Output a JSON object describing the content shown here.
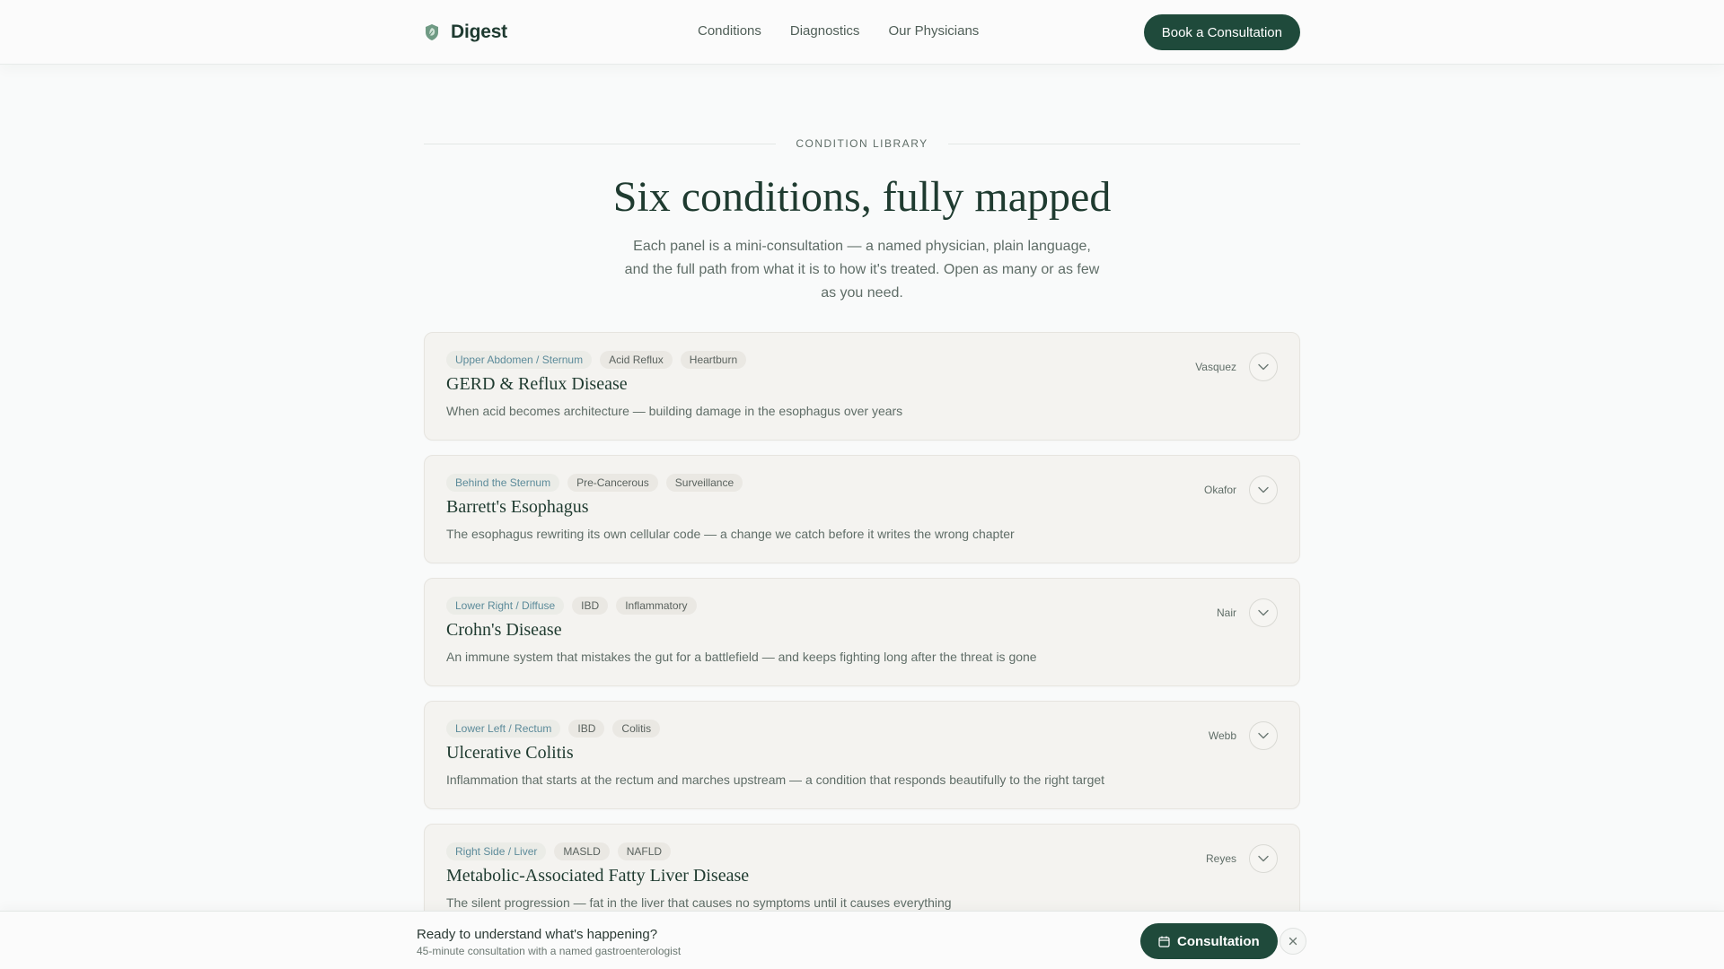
{
  "header": {
    "brand": "Digest",
    "nav": [
      "Conditions",
      "Diagnostics",
      "Our Physicians"
    ],
    "cta": "Book a Consultation"
  },
  "hero": {
    "eyebrow": "CONDITION LIBRARY",
    "title": "Six conditions, fully mapped",
    "subtitle": "Each panel is a mini-consultation — a named physician, plain language, and the full path from what it is to how it's treated. Open as many or as few as you need."
  },
  "conditions": [
    {
      "tags": [
        "Upper Abdomen / Sternum",
        "Acid Reflux",
        "Heartburn"
      ],
      "title": "GERD & Reflux Disease",
      "description": "When acid becomes architecture — building damage in the esophagus over years",
      "physician": "Vasquez"
    },
    {
      "tags": [
        "Behind the Sternum",
        "Pre-Cancerous",
        "Surveillance"
      ],
      "title": "Barrett's Esophagus",
      "description": "The esophagus rewriting its own cellular code — a change we catch before it writes the wrong chapter",
      "physician": "Okafor"
    },
    {
      "tags": [
        "Lower Right / Diffuse",
        "IBD",
        "Inflammatory"
      ],
      "title": "Crohn's Disease",
      "description": "An immune system that mistakes the gut for a battlefield — and keeps fighting long after the threat is gone",
      "physician": "Nair"
    },
    {
      "tags": [
        "Lower Left / Rectum",
        "IBD",
        "Colitis"
      ],
      "title": "Ulcerative Colitis",
      "description": "Inflammation that starts at the rectum and marches upstream — a condition that responds beautifully to the right target",
      "physician": "Webb"
    },
    {
      "tags": [
        "Right Side / Liver",
        "MASLD",
        "NAFLD"
      ],
      "title": "Metabolic-Associated Fatty Liver Disease",
      "description": "The silent progression — fat in the liver that causes no symptoms until it causes everything",
      "physician": "Reyes"
    }
  ],
  "sticky": {
    "title": "Ready to understand what's happening?",
    "subtitle": "45-minute consultation with a named gastroenterologist",
    "button": "Consultation"
  },
  "colors": {
    "brand": "#1f4a3b",
    "card_bg": "#f4f3f0",
    "location_tag_text": "#5c8b9a"
  }
}
